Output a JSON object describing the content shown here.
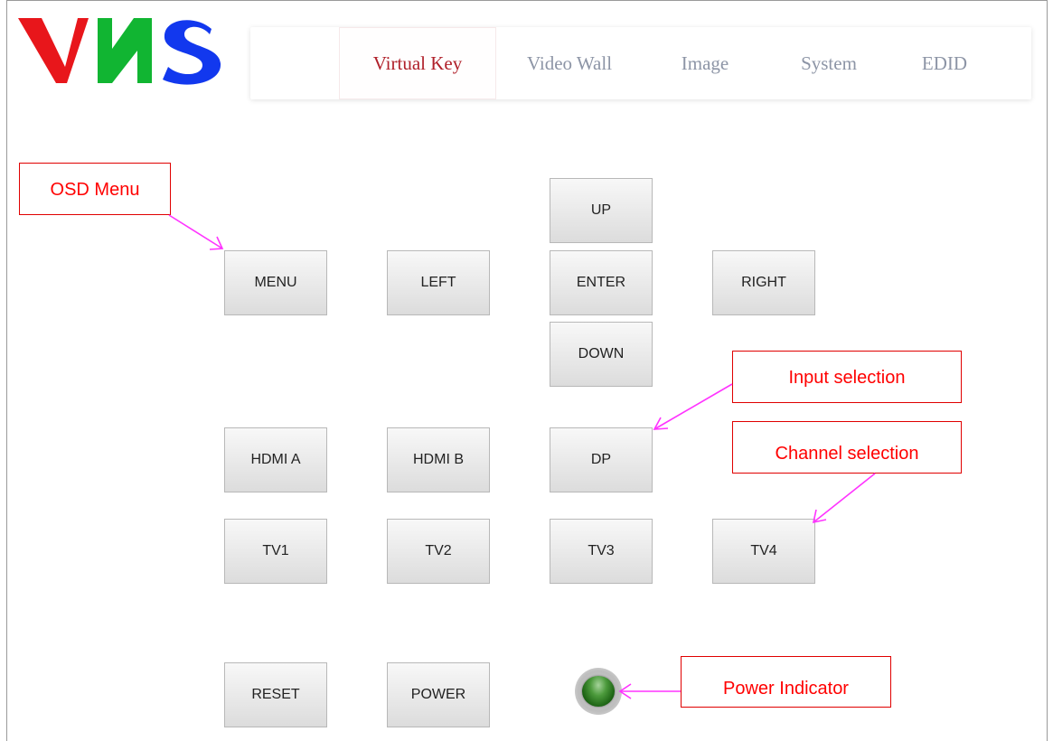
{
  "logo": {
    "letters": [
      "V",
      "N",
      "S"
    ],
    "colors": [
      "#e8161b",
      "#11b532",
      "#1238ee"
    ]
  },
  "nav": {
    "tabs": [
      {
        "label": "Virtual Key",
        "active": true
      },
      {
        "label": "Video Wall",
        "active": false
      },
      {
        "label": "Image",
        "active": false
      },
      {
        "label": "System",
        "active": false
      },
      {
        "label": "EDID",
        "active": false
      }
    ],
    "active_color": "#b0202a",
    "inactive_color": "#8d95a6"
  },
  "keys": {
    "menu": "MENU",
    "left": "LEFT",
    "up": "UP",
    "enter": "ENTER",
    "down": "DOWN",
    "right": "RIGHT",
    "hdmi_a": "HDMI A",
    "hdmi_b": "HDMI B",
    "dp": "DP",
    "tv1": "TV1",
    "tv2": "TV2",
    "tv3": "TV3",
    "tv4": "TV4",
    "reset": "RESET",
    "power": "POWER"
  },
  "callouts": {
    "osd_menu": "OSD Menu",
    "input_selection": "Input selection",
    "channel_selection": "Channel selection",
    "power_indicator": "Power Indicator"
  },
  "indicator": {
    "state": "on",
    "color": "#2f7f22"
  },
  "annotation_colors": {
    "callout": "#ff0000",
    "arrow": "#ff33ff"
  }
}
